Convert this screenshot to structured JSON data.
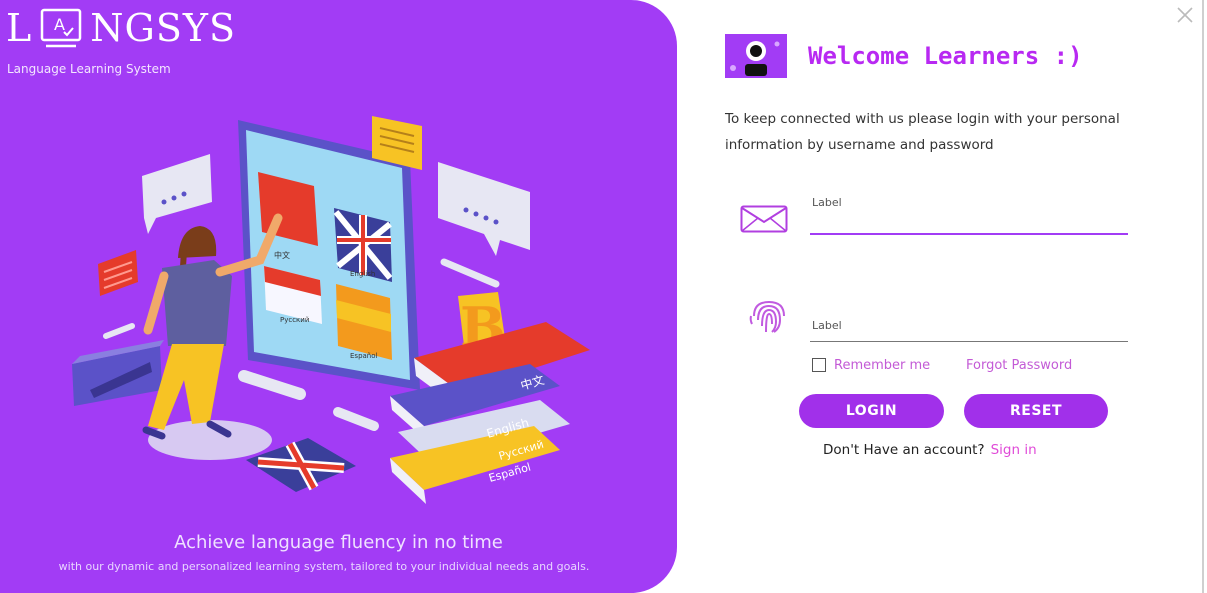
{
  "brand": {
    "logo_prefix": "L",
    "logo_suffix": "NGSYS",
    "tagline": "Language Learning System"
  },
  "hero": {
    "headline": "Achieve language fluency in no time",
    "subline": "with our dynamic and personalized learning system, tailored to your individual needs and goals.",
    "book_labels": [
      "中文",
      "English",
      "Русский",
      "Español"
    ],
    "card_labels": [
      "English",
      "Русский",
      "Español"
    ]
  },
  "login": {
    "welcome": "Welcome Learners :)",
    "description": "To keep connected with us please login with your personal information by username and password",
    "username_label": "Label",
    "password_label": "Label",
    "remember_me": "Remember me",
    "forgot_password": "Forgot Password",
    "login_button": "LOGIN",
    "reset_button": "RESET",
    "no_account": "Don't Have an account?",
    "sign_in": "Sign in"
  },
  "colors": {
    "brand_purple": "#a23cf5",
    "button_purple": "#a130ea",
    "accent_magenta": "#b829f2",
    "link_pink": "#c35ad6"
  },
  "icons": [
    "mail-icon",
    "fingerprint-icon",
    "close-icon",
    "avatar-icon"
  ]
}
